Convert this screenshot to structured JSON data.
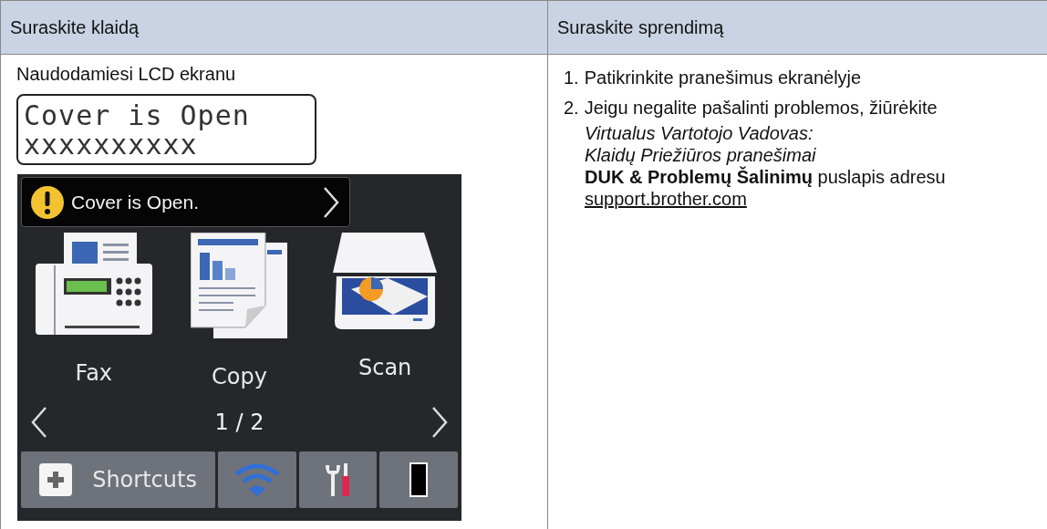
{
  "table": {
    "columns": [
      "Suraskite klaidą",
      "Suraskite sprendimą"
    ],
    "left": {
      "caption": "Naudodamiesi LCD ekranu",
      "lcd_lines": [
        "Cover is Open",
        "xxxxxxxxxx"
      ],
      "touchscreen": {
        "alert": "Cover is Open.",
        "tiles": [
          {
            "kind": "fax",
            "label": "Fax"
          },
          {
            "kind": "copy",
            "label": "Copy"
          },
          {
            "kind": "scan",
            "label": "Scan"
          }
        ],
        "page": "1 / 2",
        "shortcuts": "Shortcuts"
      }
    },
    "right": {
      "steps": [
        {
          "number": "1.",
          "text": "Patikrinkite pranešimus ekranėlyje"
        },
        {
          "number": "2.",
          "text": "Jeigu negalite pašalinti problemos, žiūrėkite"
        }
      ],
      "references": [
        {
          "kind": "italic",
          "text": "Virtualus Vartotojo Vadovas:"
        },
        {
          "kind": "italic",
          "text": "Klaidų Priežiūros pranešimai"
        },
        {
          "kind": "plain",
          "text": "**DUK & Problemų Šalinimų** puslapis adresu"
        },
        {
          "kind": "link",
          "text": "support.brother.com"
        }
      ]
    }
  }
}
